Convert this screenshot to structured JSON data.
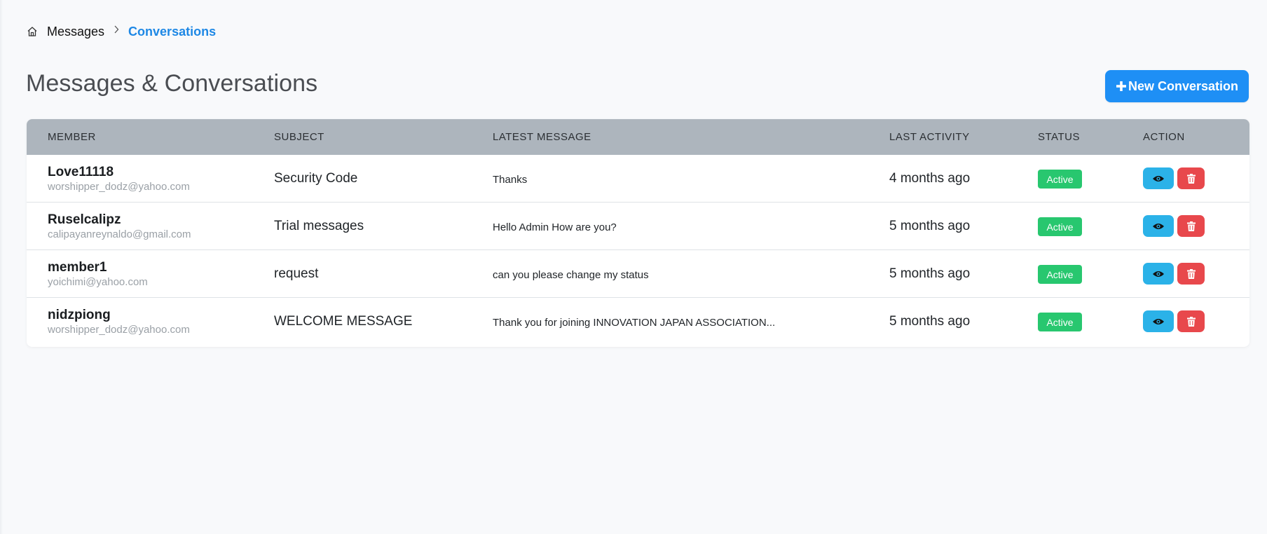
{
  "breadcrumb": {
    "home_icon": "home-icon",
    "items": [
      "Messages",
      "Conversations"
    ]
  },
  "header": {
    "title": "Messages & Conversations",
    "new_button_label": "New Conversation",
    "new_button_icon": "plus-icon"
  },
  "colors": {
    "accent": "#1e8ff5",
    "breadcrumb_active": "#1e88e5",
    "header_bg": "#adb5bd",
    "status_active": "#28c76f",
    "view_button": "#2bb2e8",
    "delete_button": "#e8484c"
  },
  "table": {
    "columns": [
      "MEMBER",
      "SUBJECT",
      "LATEST MESSAGE",
      "LAST ACTIVITY",
      "STATUS",
      "ACTION"
    ],
    "rows": [
      {
        "member_name": "Love11118",
        "member_email": "worshipper_dodz@yahoo.com",
        "subject": "Security Code",
        "latest_message": "Thanks",
        "last_activity": "4 months ago",
        "status": "Active"
      },
      {
        "member_name": "Ruselcalipz",
        "member_email": "calipayanreynaldo@gmail.com",
        "subject": "Trial messages",
        "latest_message": "Hello Admin How are you?",
        "last_activity": "5 months ago",
        "status": "Active"
      },
      {
        "member_name": "member1",
        "member_email": "yoichimi@yahoo.com",
        "subject": "request",
        "latest_message": "can you please change my status",
        "last_activity": "5 months ago",
        "status": "Active"
      },
      {
        "member_name": "nidzpiong",
        "member_email": "worshipper_dodz@yahoo.com",
        "subject": "WELCOME MESSAGE",
        "latest_message": "Thank you for joining INNOVATION JAPAN ASSOCIATION...",
        "last_activity": "5 months ago",
        "status": "Active"
      }
    ],
    "action_icons": [
      "eye-icon",
      "trash-icon"
    ]
  }
}
